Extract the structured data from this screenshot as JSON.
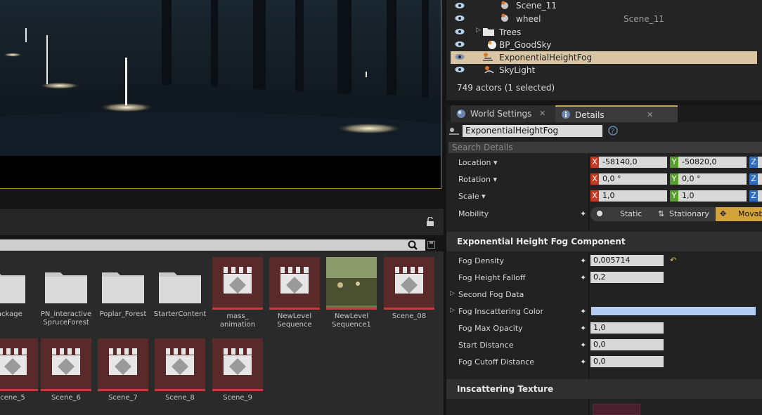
{
  "content_browser": {
    "assets_row1": [
      {
        "label": "rePackage",
        "kind": "folder"
      },
      {
        "label": "PN_interactive SpruceForest",
        "kind": "folder"
      },
      {
        "label": "Poplar_Forest",
        "kind": "folder"
      },
      {
        "label": "StarterContent",
        "kind": "folder"
      },
      {
        "label": "mass_ animation",
        "kind": "sequence"
      },
      {
        "label": "NewLevel Sequence",
        "kind": "sequence"
      },
      {
        "label": "NewLevel Sequence1",
        "kind": "image"
      },
      {
        "label": "Scene_08",
        "kind": "sequence"
      }
    ],
    "assets_row2": [
      {
        "label": "cene_5"
      },
      {
        "label": "Scene_6"
      },
      {
        "label": "Scene_7"
      },
      {
        "label": "Scene_8"
      },
      {
        "label": "Scene_9"
      }
    ]
  },
  "outliner": {
    "rows": [
      {
        "label": "Scene_11",
        "type": ""
      },
      {
        "label": "wheel",
        "type": "Scene_11"
      },
      {
        "label": "Trees",
        "type": ""
      },
      {
        "label": "BP_GoodSky",
        "type": ""
      },
      {
        "label": "ExponentialHeightFog",
        "type": ""
      },
      {
        "label": "SkyLight",
        "type": ""
      }
    ],
    "status": "749 actors (1 selected)"
  },
  "tabs": {
    "world_settings": "World Settings",
    "details": "Details"
  },
  "details": {
    "object_name": "ExponentialHeightFog",
    "search_placeholder": "Search Details",
    "transform": {
      "location_label": "Location",
      "rotation_label": "Rotation",
      "scale_label": "Scale",
      "mobility_label": "Mobility",
      "location": {
        "x": "-58140,0",
        "y": "-50820,0"
      },
      "rotation": {
        "x": "0,0 °",
        "y": "0,0 °"
      },
      "scale": {
        "x": "1,0",
        "y": "1,0"
      },
      "axis_x": "X",
      "axis_y": "Y",
      "axis_z": "Z",
      "mobility_options": [
        "Static",
        "Stationary",
        "Movab"
      ]
    },
    "section_fog": "Exponential Height Fog Component",
    "fog_props": [
      {
        "label": "Fog Density",
        "value": "0,005714"
      },
      {
        "label": "Fog Height Falloff",
        "value": "0,2"
      },
      {
        "label": "Second Fog Data",
        "value": ""
      },
      {
        "label": "Fog Inscattering Color",
        "value": ""
      },
      {
        "label": "Fog Max Opacity",
        "value": "1,0"
      },
      {
        "label": "Start Distance",
        "value": "0,0"
      },
      {
        "label": "Fog Cutoff Distance",
        "value": "0,0"
      }
    ],
    "section_inscattering": "Inscattering Texture"
  },
  "colors": {
    "accent": "#d3a33b",
    "inscattering": "#b5cdf5",
    "selected_row": "#d9c4a3"
  }
}
